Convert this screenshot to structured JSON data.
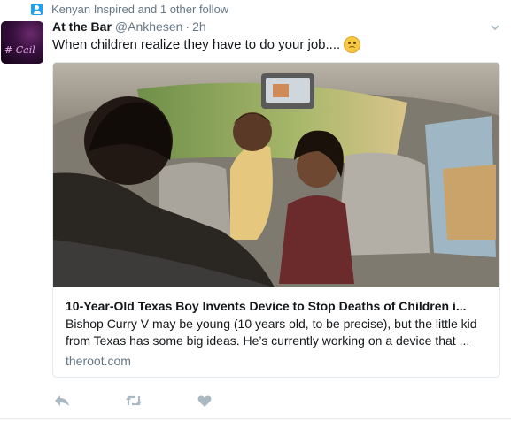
{
  "social_context": {
    "text": "Kenyan Inspired and 1 other follow"
  },
  "tweet": {
    "author_name": "At the Bar",
    "handle": "@Ankhesen",
    "separator": "·",
    "time": "2h",
    "text": "When children realize they have to do your job....",
    "emoji": "disappointed-face"
  },
  "avatar": {
    "text": "# Cail"
  },
  "card": {
    "title": "10-Year-Old Texas Boy Invents Device to Stop Deaths of Children i...",
    "description": "Bishop Curry V may be young (10 years old, to be precise), but the little kid from Texas has some big ideas. He’s currently working on a device that ...",
    "domain": "theroot.com"
  },
  "actions": [
    "reply-icon",
    "retweet-icon",
    "like-icon"
  ],
  "colors": {
    "accent": "#1da1f2",
    "muted": "#657786",
    "icon": "#aab8c2",
    "border": "#e1e8ed"
  }
}
